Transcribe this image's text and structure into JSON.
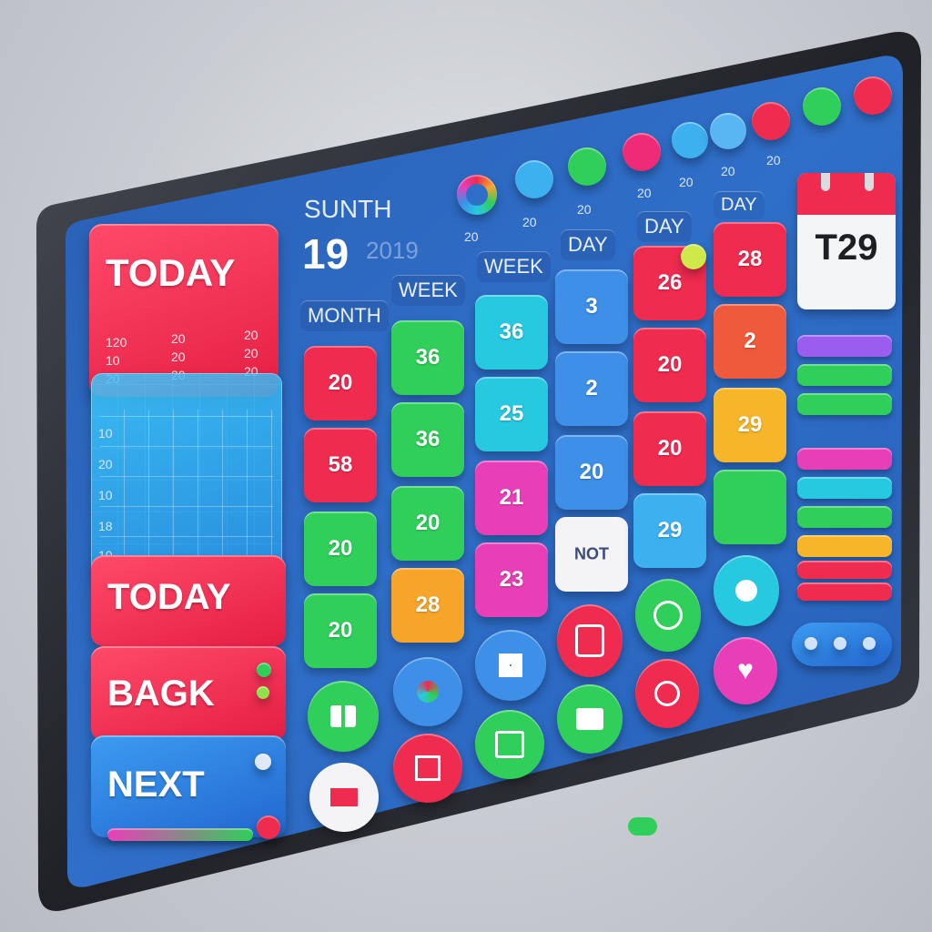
{
  "header": {
    "month_label": "SUNTH",
    "big_number": "19",
    "year_faded": "2019"
  },
  "view_tabs": [
    {
      "label": "MONTH"
    },
    {
      "label": "WEEK"
    },
    {
      "label": "WEEK"
    },
    {
      "label": "DAY"
    },
    {
      "label": "DAY"
    },
    {
      "label": "DAY"
    }
  ],
  "top_small_labels": [
    "20",
    "20",
    "20",
    "20",
    "20",
    "20",
    "20"
  ],
  "calendar_badge": {
    "text": "T29"
  },
  "buttons": {
    "today_top": "TODAY",
    "today_mid": "TODAY",
    "back": "BAGK",
    "next": "NEXT"
  },
  "today_card_lines": [
    {
      "left": "120",
      "mid": "20",
      "right": "20"
    },
    {
      "left": "10",
      "mid": "20",
      "right": "20"
    },
    {
      "left": "20",
      "mid": "20",
      "right": "20"
    }
  ],
  "mini_calendar_rows": [
    "10",
    "20",
    "10",
    "18",
    "10"
  ],
  "tiles": [
    {
      "num": "20",
      "color": "#ef2b4f"
    },
    {
      "num": "36",
      "color": "#2fcf5a"
    },
    {
      "num": "36",
      "color": "#27c9e0"
    },
    {
      "num": "3",
      "color": "#3d8fe8"
    },
    {
      "num": "26",
      "color": "#ef2b4f"
    },
    {
      "num": "28",
      "color": "#ef2b4f"
    },
    {
      "num": "58",
      "color": "#ef2b4f"
    },
    {
      "num": "36",
      "color": "#2fcf5a"
    },
    {
      "num": "25",
      "color": "#27c9e0"
    },
    {
      "num": "2",
      "color": "#3d8fe8"
    },
    {
      "num": "20",
      "color": "#ef2b4f"
    },
    {
      "num": "2",
      "color": "#f05a3c"
    },
    {
      "num": "20",
      "color": "#2fcf5a"
    },
    {
      "num": "20",
      "color": "#2fcf5a"
    },
    {
      "num": "21",
      "color": "#e83fb8"
    },
    {
      "num": "20",
      "color": "#3d8fe8"
    },
    {
      "num": "20",
      "color": "#ef2b4f"
    },
    {
      "num": "29",
      "color": "#f7b52a"
    },
    {
      "num": "20",
      "color": "#2fcf5a"
    },
    {
      "num": "28",
      "color": "#f7a52a"
    },
    {
      "num": "23",
      "color": "#e83fb8"
    },
    {
      "num": "NOT",
      "color": "#f4f4f6"
    },
    {
      "num": "29",
      "color": "#3db0f0"
    },
    {
      "num": "",
      "color": "#2fcf5a"
    }
  ],
  "colors": {
    "panel": "#2f6fc9",
    "red": "#ef2b4f",
    "green": "#2fcf5a",
    "blue": "#3d8fe8",
    "cyan": "#27c9e0",
    "pink": "#e83fb8",
    "orange": "#f7a52a"
  }
}
